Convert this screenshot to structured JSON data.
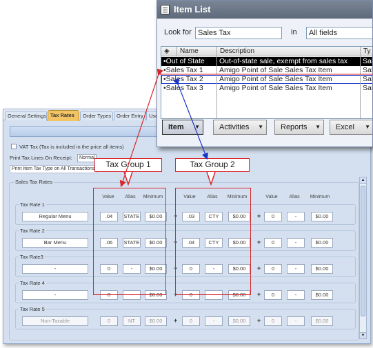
{
  "settings": {
    "tabs": [
      "General Settings",
      "Tax Rates",
      "Order Types",
      "Order Entry",
      "User"
    ],
    "active_tab": "Tax Rates",
    "vat_label": "VAT Tax (Tax is included in the price all items)",
    "print_lines_label": "Print Tax Lines On Receipt:",
    "print_lines_value": "Normal",
    "print_type_label": "Print Item Tax Type on All Transactions",
    "sales_tax_rates_title": "Sales Tax Rates",
    "col_value": "Value",
    "col_alias": "Alias",
    "col_minimum": "Minimum",
    "rates": [
      {
        "title": "Tax Rate 1",
        "name": "Regular Menu",
        "g1": [
          ".04",
          "STATE",
          "$0.00"
        ],
        "g2": [
          ".03",
          "CTY",
          "$0.00"
        ],
        "g3": [
          "0",
          "-",
          "$0.00"
        ]
      },
      {
        "title": "Tax Rate 2",
        "name": "Bar Menu",
        "g1": [
          ".06",
          "STATE",
          "$0.00"
        ],
        "g2": [
          ".04",
          "CTY",
          "$0.00"
        ],
        "g3": [
          "0",
          "-",
          "$0.00"
        ]
      },
      {
        "title": "Tax Rate3",
        "name": "-",
        "g1": [
          "0",
          "-",
          "$0.00"
        ],
        "g2": [
          "0",
          "-",
          "$0.00"
        ],
        "g3": [
          "0",
          "-",
          "$0.00"
        ]
      },
      {
        "title": "Tax Rate 4",
        "name": "-",
        "g1": [
          "0",
          "-",
          "$0.00"
        ],
        "g2": [
          "0",
          "-",
          "$0.00"
        ],
        "g3": [
          "0",
          "-",
          "$0.00"
        ]
      },
      {
        "title": "Tax Rate 5",
        "name": "Non-Taxable",
        "g1": [
          "0",
          "NT",
          "$0.00"
        ],
        "g2": [
          "0",
          "-",
          "$0.00"
        ],
        "g3": [
          "0",
          "-",
          "$0.00"
        ]
      }
    ]
  },
  "callouts": {
    "group1": "Tax Group 1",
    "group2": "Tax Group 2"
  },
  "item_list": {
    "title": "Item List",
    "look_for_label": "Look for",
    "look_for_value": "Sales Tax",
    "in_label": "in",
    "in_value": "All fields",
    "columns": [
      "Name",
      "Description",
      "Ty"
    ],
    "rows": [
      {
        "name": "•Out of State",
        "description": "Out-of-state sale, exempt from sales tax",
        "type": "Sale",
        "selected": true
      },
      {
        "name": "•Sales Tax 1",
        "description": "Amigo Point of Sale Sales Tax Item",
        "type": "Sale",
        "selected": false
      },
      {
        "name": "•Sales Tax 2",
        "description": "Amigo Point of Sale Sales Tax Item",
        "type": "Sale",
        "selected": false
      },
      {
        "name": "•Sales Tax 3",
        "description": "Amigo Point of Sale Sales Tax Item",
        "type": "Sale",
        "selected": false
      }
    ],
    "buttons": [
      "Item",
      "Activities",
      "Reports",
      "Excel"
    ]
  },
  "colors": {
    "accent_red": "#d8252a",
    "accent_blue": "#1a33c8",
    "active_tab": "#f2c464"
  }
}
